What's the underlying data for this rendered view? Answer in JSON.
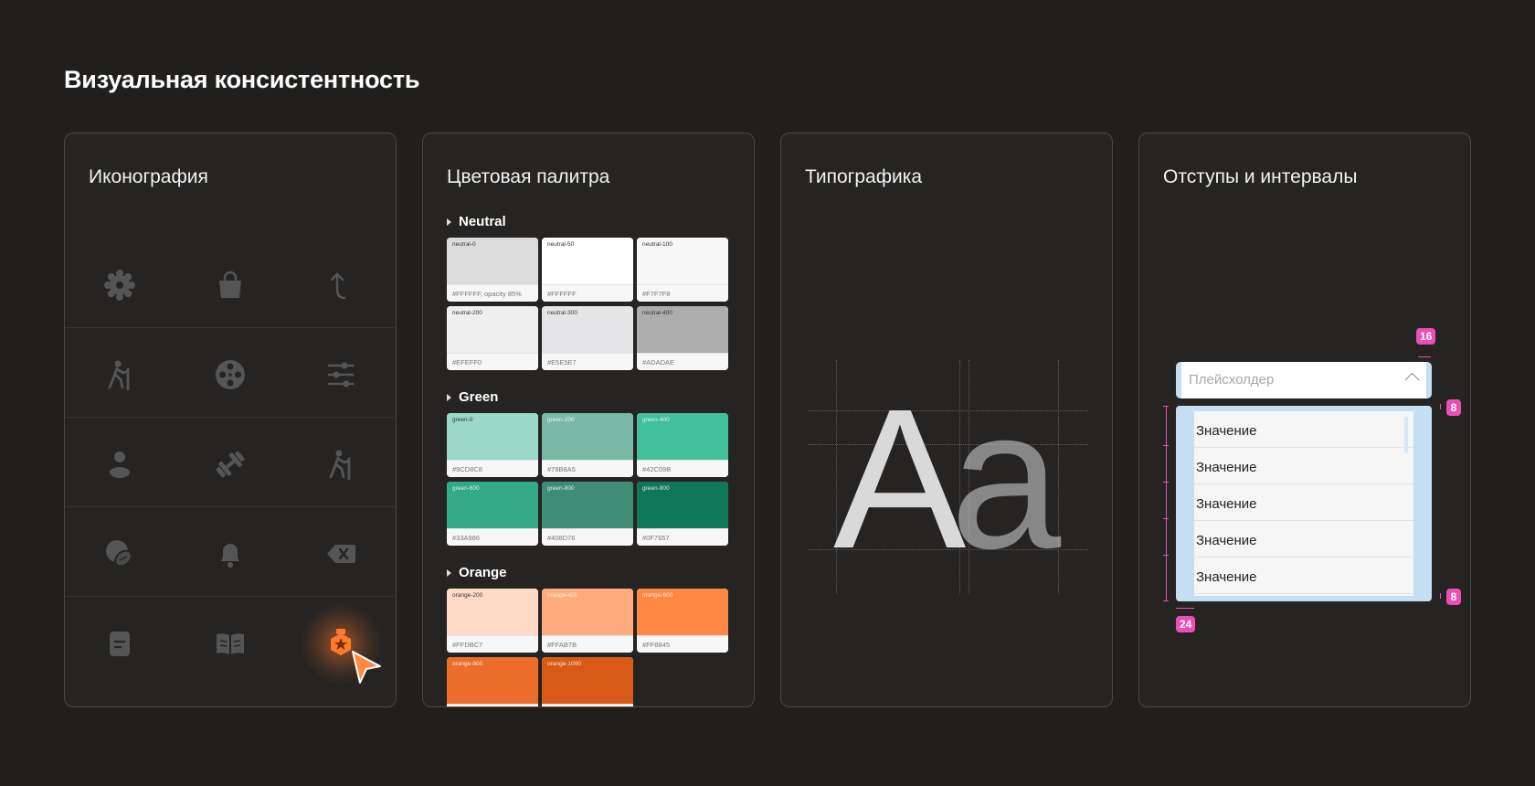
{
  "page": {
    "title": "Визуальная консистентность"
  },
  "cards": {
    "iconography": {
      "title": "Иконография"
    },
    "palette": {
      "title": "Цветовая палитра",
      "groups": [
        {
          "name": "Neutral",
          "swatches": [
            {
              "name": "neutral-0",
              "hex": "#FFFFFF, opacity 85%",
              "color": "#dcdcdc"
            },
            {
              "name": "neutral-50",
              "hex": "#FFFFFF",
              "color": "#ffffff"
            },
            {
              "name": "neutral-100",
              "hex": "#F7F7F8",
              "color": "#f7f7f8"
            },
            {
              "name": "neutral-200",
              "hex": "#EFEFF0",
              "color": "#efeff0"
            },
            {
              "name": "neutral-300",
              "hex": "#E5E5E7",
              "color": "#e5e5e7"
            },
            {
              "name": "neutral-400",
              "hex": "#ADADAE",
              "color": "#adadae"
            }
          ]
        },
        {
          "name": "Green",
          "swatches": [
            {
              "name": "green-0",
              "hex": "#9CD8C8",
              "color": "#9cd8c8"
            },
            {
              "name": "green-200",
              "hex": "#79B8A5",
              "color": "#79b8a5"
            },
            {
              "name": "green-400",
              "hex": "#42C09B",
              "color": "#42c09b"
            },
            {
              "name": "green-600",
              "hex": "#33A986",
              "color": "#33a986"
            },
            {
              "name": "green-800",
              "hex": "#408D76",
              "color": "#408d76"
            },
            {
              "name": "green-900",
              "hex": "#0F7657",
              "color": "#0f7657"
            }
          ]
        },
        {
          "name": "Orange",
          "swatches": [
            {
              "name": "orange-200",
              "hex": "#FFDBC7",
              "color": "#ffdbc7"
            },
            {
              "name": "orange-400",
              "hex": "#FFAB7B",
              "color": "#ffab7b"
            },
            {
              "name": "orange-600",
              "hex": "#FF8845",
              "color": "#ff8845"
            },
            {
              "name": "orange-800",
              "hex": "",
              "color": "#ec6e2a"
            },
            {
              "name": "orange-1000",
              "hex": "",
              "color": "#d95a16"
            }
          ]
        }
      ]
    },
    "typography": {
      "title": "Типографика",
      "sample_upper": "A",
      "sample_lower": "a"
    },
    "spacing": {
      "title": "Отступы и интервалы",
      "select_placeholder": "Плейсхолдер",
      "options": [
        "Значение",
        "Значение",
        "Значение",
        "Значение",
        "Значение"
      ],
      "badges": {
        "right_top": "16",
        "gap_top": "8",
        "gap_bottom": "8",
        "left_bottom": "24"
      }
    }
  },
  "colors": {
    "background": "#201f1e",
    "card": "#252423",
    "accent": "#ff7a2f",
    "measure": "#e94fb5",
    "select_highlight": "#c6def2"
  },
  "icons": [
    [
      "gear-icon",
      "bag-icon",
      "arrow-turn-up-icon"
    ],
    [
      "hiker-icon",
      "film-reel-icon",
      "sliders-icon"
    ],
    [
      "user-icon",
      "dumbbell-icon",
      "hiker-icon"
    ],
    [
      "sports-balls-icon",
      "bell-icon",
      "backspace-icon"
    ],
    [
      "note-icon",
      "open-book-icon",
      "award-medal-icon"
    ]
  ]
}
